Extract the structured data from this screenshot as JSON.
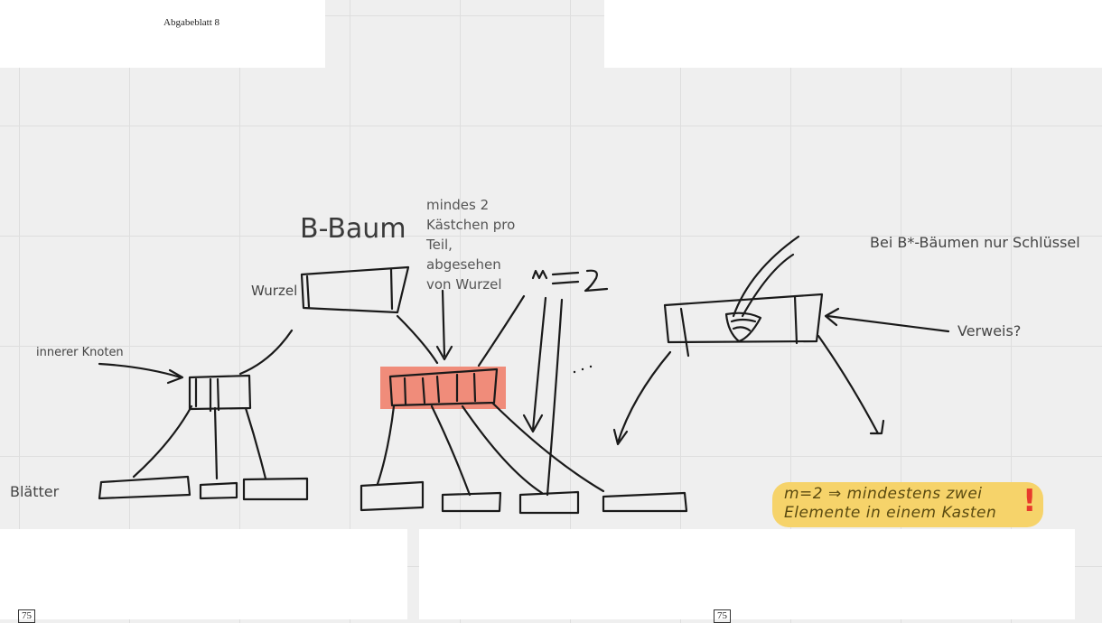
{
  "pages": {
    "top_left_title": "Abgabeblatt 8",
    "bottom_left_number": "75",
    "bottom_right_number": "75"
  },
  "diagram": {
    "title": "B-Baum",
    "note": "mindes 2 Kästchen pro Teil, abgesehen von Wurzel",
    "root_label": "Wurzel",
    "inner_label": "innerer Knoten",
    "leaves_label": "Blätter",
    "m_label": "m=2",
    "ellipsis": "...",
    "bstar_note": "Bei B*-Bäumen nur Schlüssel",
    "pointer_label": "Verweis?"
  },
  "sticker": {
    "line1": "m=2 ⇒ mindestens zwei",
    "line2": "Elemente in einem Kasten",
    "mark": "!"
  },
  "colors": {
    "highlight": "#f08c7a",
    "sticker": "#f6d36a",
    "exclamation": "#e83a2c"
  }
}
